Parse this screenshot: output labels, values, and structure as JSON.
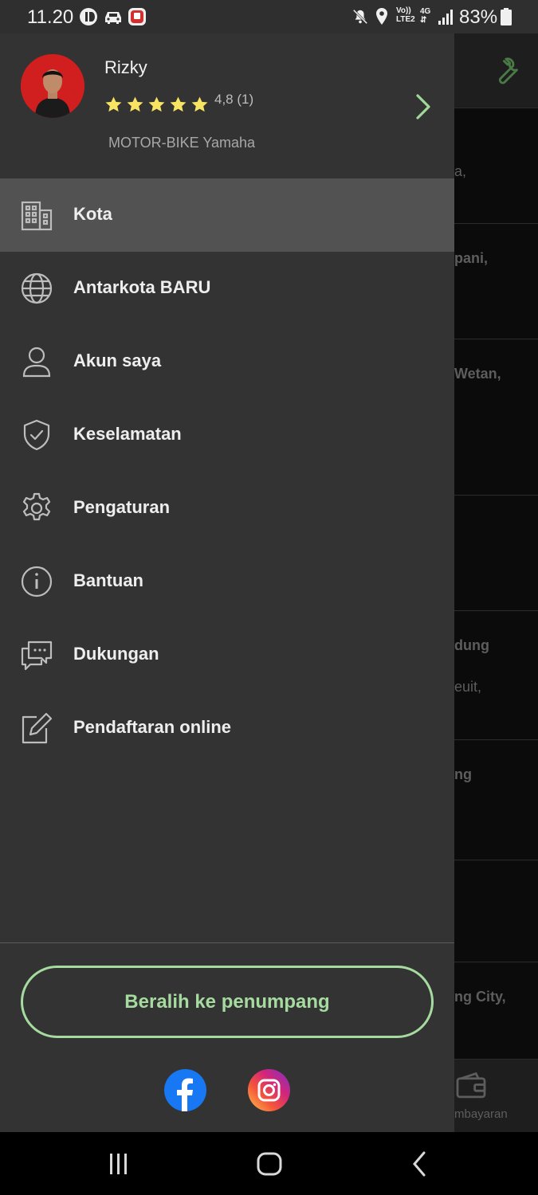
{
  "status_bar": {
    "time": "11.20",
    "battery": "83%",
    "network_small_top": "Vo))",
    "network_small_bottom": "LTE2",
    "network_type": "4G"
  },
  "background": {
    "texts": [
      "a,",
      "pani,",
      "Wetan,",
      "dung",
      "euit,",
      "ng",
      "ng City,"
    ],
    "bottom_label": "mbayaran"
  },
  "profile": {
    "name": "Rizky",
    "rating": "4,8 (1)",
    "star_count": 5,
    "vehicle": "MOTOR-BIKE Yamaha"
  },
  "menu": {
    "items": [
      {
        "label": "Kota",
        "icon": "building-icon",
        "active": true
      },
      {
        "label": "Antarkota BARU",
        "icon": "globe-icon",
        "active": false
      },
      {
        "label": "Akun saya",
        "icon": "user-icon",
        "active": false
      },
      {
        "label": "Keselamatan",
        "icon": "shield-check-icon",
        "active": false
      },
      {
        "label": "Pengaturan",
        "icon": "gear-icon",
        "active": false
      },
      {
        "label": "Bantuan",
        "icon": "info-icon",
        "active": false
      },
      {
        "label": "Dukungan",
        "icon": "chat-icon",
        "active": false
      },
      {
        "label": "Pendaftaran online",
        "icon": "edit-icon",
        "active": false
      }
    ]
  },
  "switch_button": {
    "label": "Beralih ke penumpang"
  },
  "colors": {
    "accent": "#a6dba0",
    "drawer_bg": "#333333",
    "active_item_bg": "#525252",
    "star": "#f7e463"
  }
}
